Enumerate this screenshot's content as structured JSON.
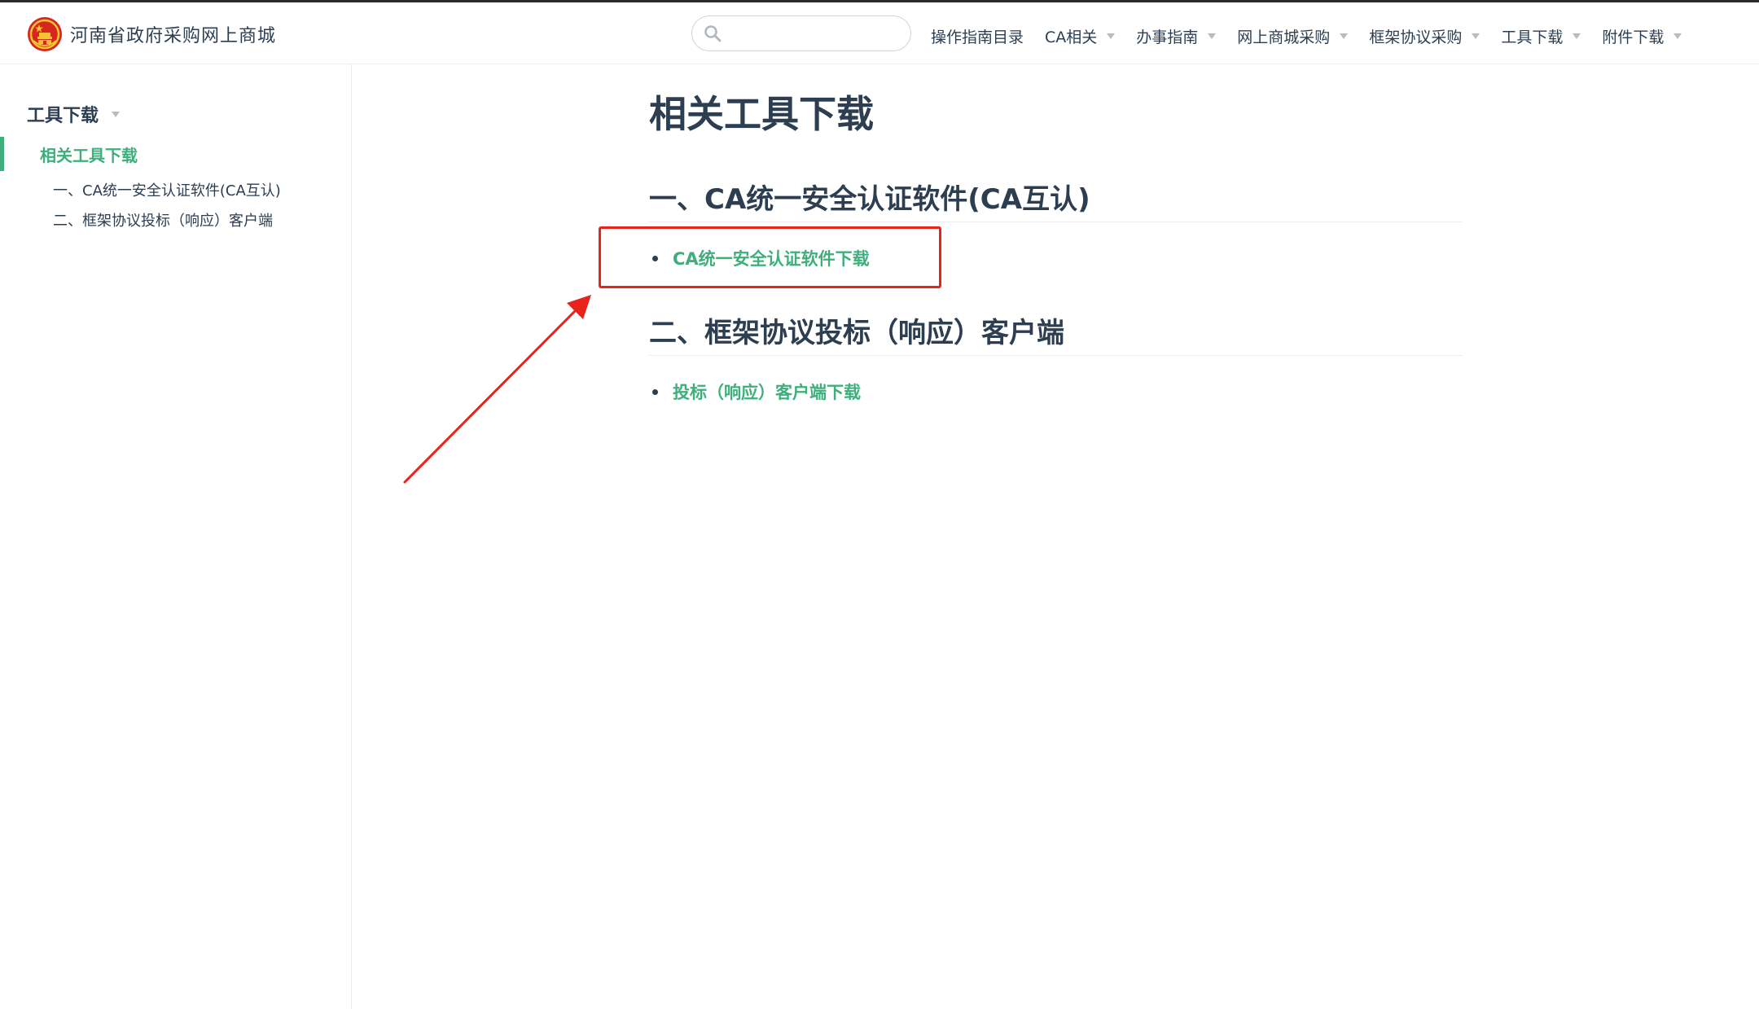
{
  "site": {
    "name": "河南省政府采购网上商城"
  },
  "search": {
    "placeholder": "",
    "value": ""
  },
  "nav": {
    "items": [
      {
        "label": "操作指南目录",
        "dropdown": false
      },
      {
        "label": "CA相关",
        "dropdown": true
      },
      {
        "label": "办事指南",
        "dropdown": true
      },
      {
        "label": "网上商城采购",
        "dropdown": true
      },
      {
        "label": "框架协议采购",
        "dropdown": true
      },
      {
        "label": "工具下载",
        "dropdown": true
      },
      {
        "label": "附件下载",
        "dropdown": true
      }
    ]
  },
  "sidebar": {
    "heading": "工具下载",
    "active_item": "相关工具下载",
    "sub_items": [
      "一、CA统一安全认证软件(CA互认)",
      "二、框架协议投标（响应）客户端"
    ]
  },
  "content": {
    "title": "相关工具下载",
    "sections": [
      {
        "title": "一、CA统一安全认证软件(CA互认)",
        "link": "CA统一安全认证软件下载"
      },
      {
        "title": "二、框架协议投标（响应）客户端",
        "link": "投标（响应）客户端下载"
      }
    ]
  },
  "colors": {
    "accent": "#3eaf7c",
    "text": "#2c3e50",
    "annotation": "#e8231c",
    "border": "#eaecef"
  },
  "icons": {
    "logo": "national-emblem-icon",
    "search": "search-icon",
    "caret": "caret-down-icon",
    "annotation_arrow": "arrow-icon"
  }
}
